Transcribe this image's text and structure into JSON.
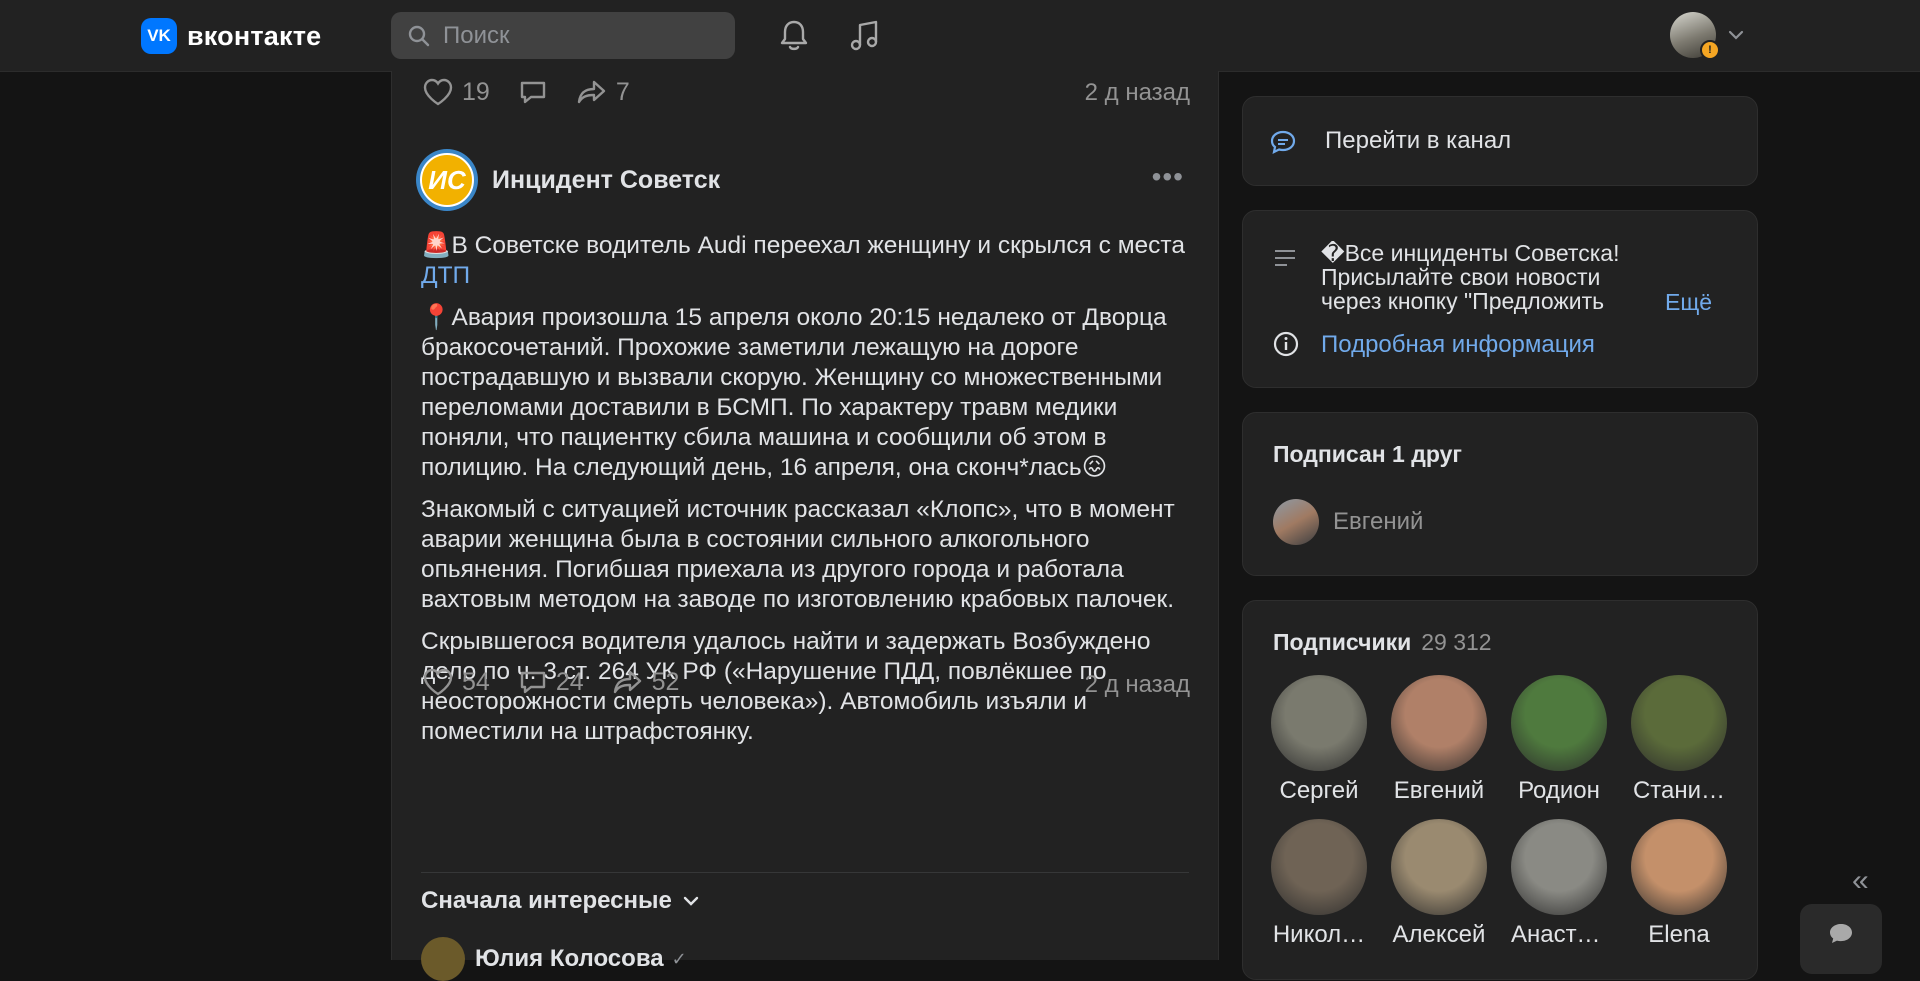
{
  "header": {
    "logo_text": "вконтакте",
    "search_placeholder": "Поиск",
    "profile_badge": "!"
  },
  "prev_post": {
    "likes": "19",
    "shares": "7",
    "time": "2 д назад"
  },
  "post": {
    "author": "Инцидент Советск",
    "avatar_text": "ИС",
    "title_emoji": "🚨",
    "title": "В Советске водитель Audi переехал женщину и скрылся с места ",
    "title_link": "ДТП",
    "p1_emoji": "📍",
    "p1": "Авария произошла 15 апреля около 20:15 недалеко от Дворца бракосочетаний. Прохожие заметили лежащую на дороге пострадавшую и вызвали скорую. Женщину со множественными переломами доставили в БСМП. По характеру травм медики поняли, что пациентку сбила машина и сообщили об этом в полицию. На следующий день, 16 апреля, она сконч*лась",
    "p1_end_emoji": "😖",
    "p2": "Знакомый с ситуацией источник рассказал «Клопс», что в момент аварии женщина была в состоянии сильного алкогольного опьянения. Погибшая приехала из другого города и работала вахтовым методом на заводе по изготовлению крабовых палочек.",
    "p3": "Скрывшегося водителя удалось найти и задержать Возбуждено дело по ч. 3 ст. 264 УК РФ («Нарушение ПДД, повлёкшее по неосторожности смерть человека»). Автомобиль изъяли и поместили на штрафстоянку.",
    "likes": "54",
    "comments": "24",
    "shares": "52",
    "time": "2 д назад"
  },
  "comments": {
    "sort_label": "Сначала интересные",
    "first_author": "Юлия Колосова"
  },
  "sidebar": {
    "channel_button": "Перейти в канал",
    "about_text": "�Все инциденты Советска! Присылайте свои новости через кнопку \"Предложить",
    "more": "Ещё",
    "info_link": "Подробная информация",
    "friends_title": "Подписан 1 друг",
    "friend_name": "Евгений",
    "subs_title": "Подписчики",
    "subs_count": "29 312",
    "subscribers": [
      {
        "name": "Сергей",
        "color": "#7a7a6e"
      },
      {
        "name": "Евгений",
        "color": "#b08068"
      },
      {
        "name": "Родион",
        "color": "#4f7a3e"
      },
      {
        "name": "Стани…",
        "color": "#5b6b3a"
      },
      {
        "name": "Никол…",
        "color": "#6f6355"
      },
      {
        "name": "Алексей",
        "color": "#9a8a70"
      },
      {
        "name": "Анаста…",
        "color": "#8a8a84"
      },
      {
        "name": "Elena",
        "color": "#c4906a"
      }
    ]
  }
}
